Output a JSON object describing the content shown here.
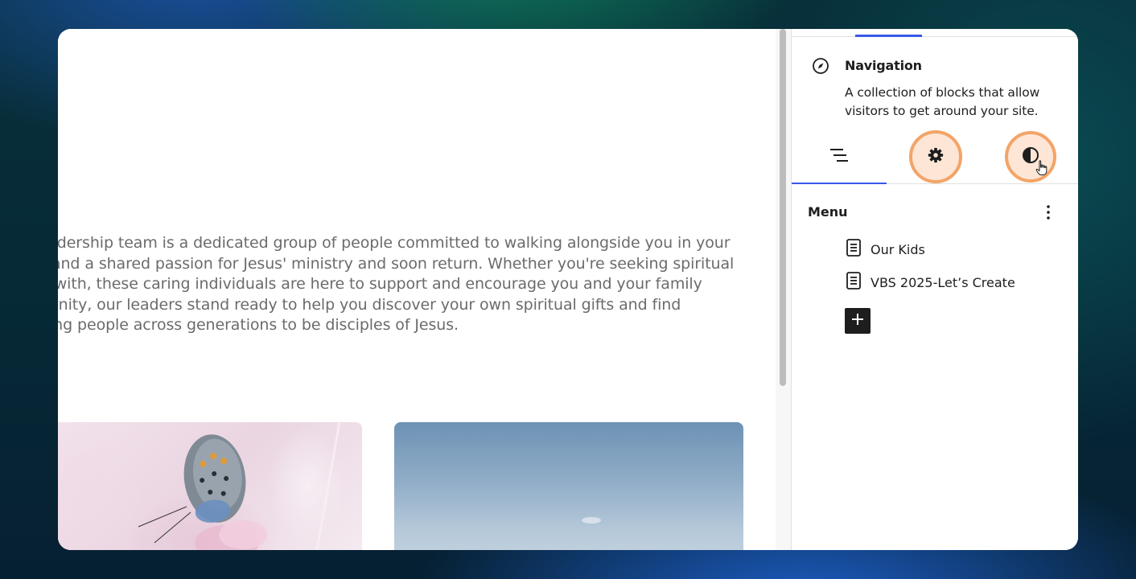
{
  "canvas": {
    "paragraph_lines": [
      "Our leadership team is a dedicated group of people committed to walking alongside you in your",
      "ideas, and a shared passion for Jesus' ministry and soon return. Whether you're seeking spiritual",
      "to talk with, these caring individuals are here to support and encourage you and your family",
      "community, our leaders stand ready to help you discover your own spiritual gifts and find",
      "engaging people across generations to be disciples of Jesus."
    ]
  },
  "sidebar": {
    "block": {
      "icon": "compass-icon",
      "title": "Navigation",
      "description": "A collection of blocks that allow visitors to get around your site."
    },
    "tabs": [
      {
        "name": "list-view",
        "icon": "list-view-icon",
        "active": true
      },
      {
        "name": "settings",
        "icon": "gear-icon",
        "highlighted": true
      },
      {
        "name": "styles",
        "icon": "contrast-icon",
        "highlighted": true
      }
    ],
    "menu": {
      "title": "Menu",
      "items": [
        {
          "label": "Our Kids",
          "icon": "page-icon"
        },
        {
          "label": "VBS 2025-Let’s Create",
          "icon": "page-icon"
        }
      ],
      "add_icon": "plus-icon"
    }
  },
  "colors": {
    "accent": "#3858e9",
    "highlight_ring": "#f3a468",
    "highlight_fill": "#fde6d6",
    "text": "#1e1e1e",
    "body_text": "#6b6b6b"
  }
}
